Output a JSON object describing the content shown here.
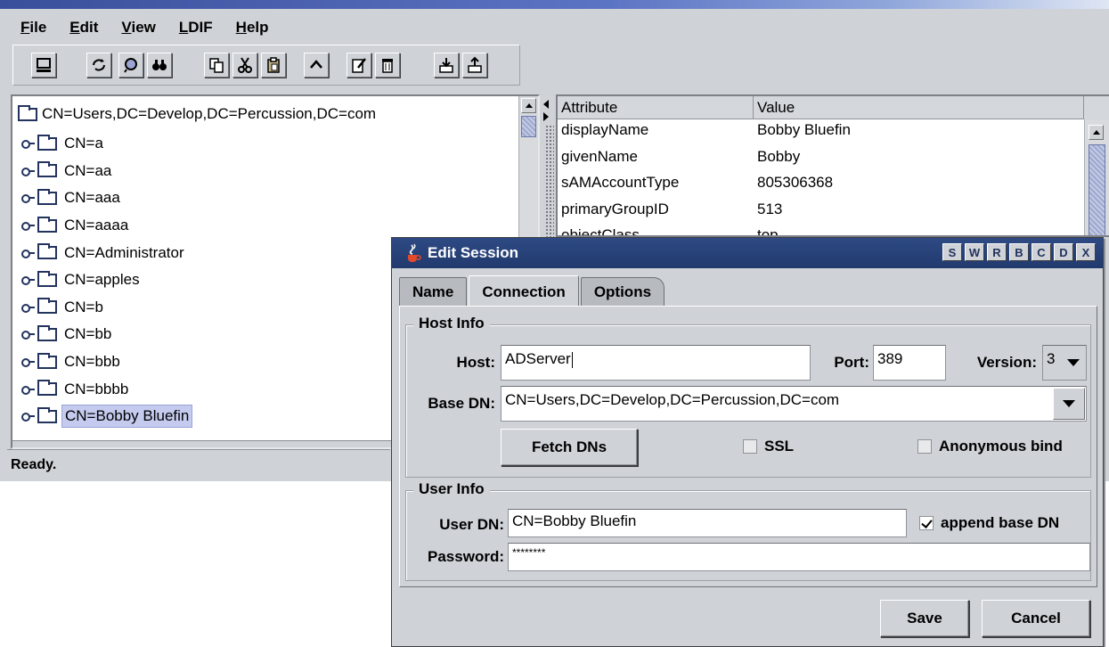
{
  "menu": [
    {
      "mnemonic": "F",
      "rest": "ile"
    },
    {
      "mnemonic": "E",
      "rest": "dit"
    },
    {
      "mnemonic": "V",
      "rest": "iew"
    },
    {
      "mnemonic": "L",
      "rest": "DIF"
    },
    {
      "mnemonic": "H",
      "rest": "elp"
    }
  ],
  "toolbar_icons": [
    "connect-icon",
    "refresh-icon",
    "search-icon",
    "find-icon",
    "copy-icon",
    "cut-icon",
    "paste-icon",
    "up-icon",
    "edit-icon",
    "delete-icon",
    "import-icon",
    "export-icon"
  ],
  "tree": {
    "root": "CN=Users,DC=Develop,DC=Percussion,DC=com",
    "items": [
      "CN=a",
      "CN=aa",
      "CN=aaa",
      "CN=aaaa",
      "CN=Administrator",
      "CN=apples",
      "CN=b",
      "CN=bb",
      "CN=bbb",
      "CN=bbbb",
      "CN=Bobby Bluefin"
    ],
    "selected_index": 10
  },
  "attributes": {
    "headers": [
      "Attribute",
      "Value"
    ],
    "rows": [
      {
        "attribute": "displayName",
        "value": "Bobby Bluefin"
      },
      {
        "attribute": "givenName",
        "value": "Bobby"
      },
      {
        "attribute": "sAMAccountType",
        "value": "805306368"
      },
      {
        "attribute": "primaryGroupID",
        "value": "513"
      },
      {
        "attribute": "objectClass",
        "value": "top"
      }
    ]
  },
  "status": "Ready.",
  "dialog": {
    "title": "Edit Session",
    "title_buttons": [
      "S",
      "W",
      "R",
      "B",
      "C",
      "D",
      "X"
    ],
    "tabs": [
      "Name",
      "Connection",
      "Options"
    ],
    "active_tab": "Connection",
    "host_info": {
      "legend": "Host Info",
      "host_label": "Host:",
      "host_value": "ADServer",
      "port_label": "Port:",
      "port_value": "389",
      "version_label": "Version:",
      "version_value": "3",
      "basedn_label": "Base DN:",
      "basedn_value": "CN=Users,DC=Develop,DC=Percussion,DC=com",
      "fetch_button": "Fetch DNs",
      "ssl_label": "SSL",
      "ssl_checked": false,
      "anon_label": "Anonymous bind",
      "anon_checked": false
    },
    "user_info": {
      "legend": "User Info",
      "userdn_label": "User DN:",
      "userdn_value": "CN=Bobby Bluefin",
      "append_label": "append base DN",
      "append_checked": true,
      "password_label": "Password:",
      "password_value": "********"
    },
    "save_button": "Save",
    "cancel_button": "Cancel"
  }
}
